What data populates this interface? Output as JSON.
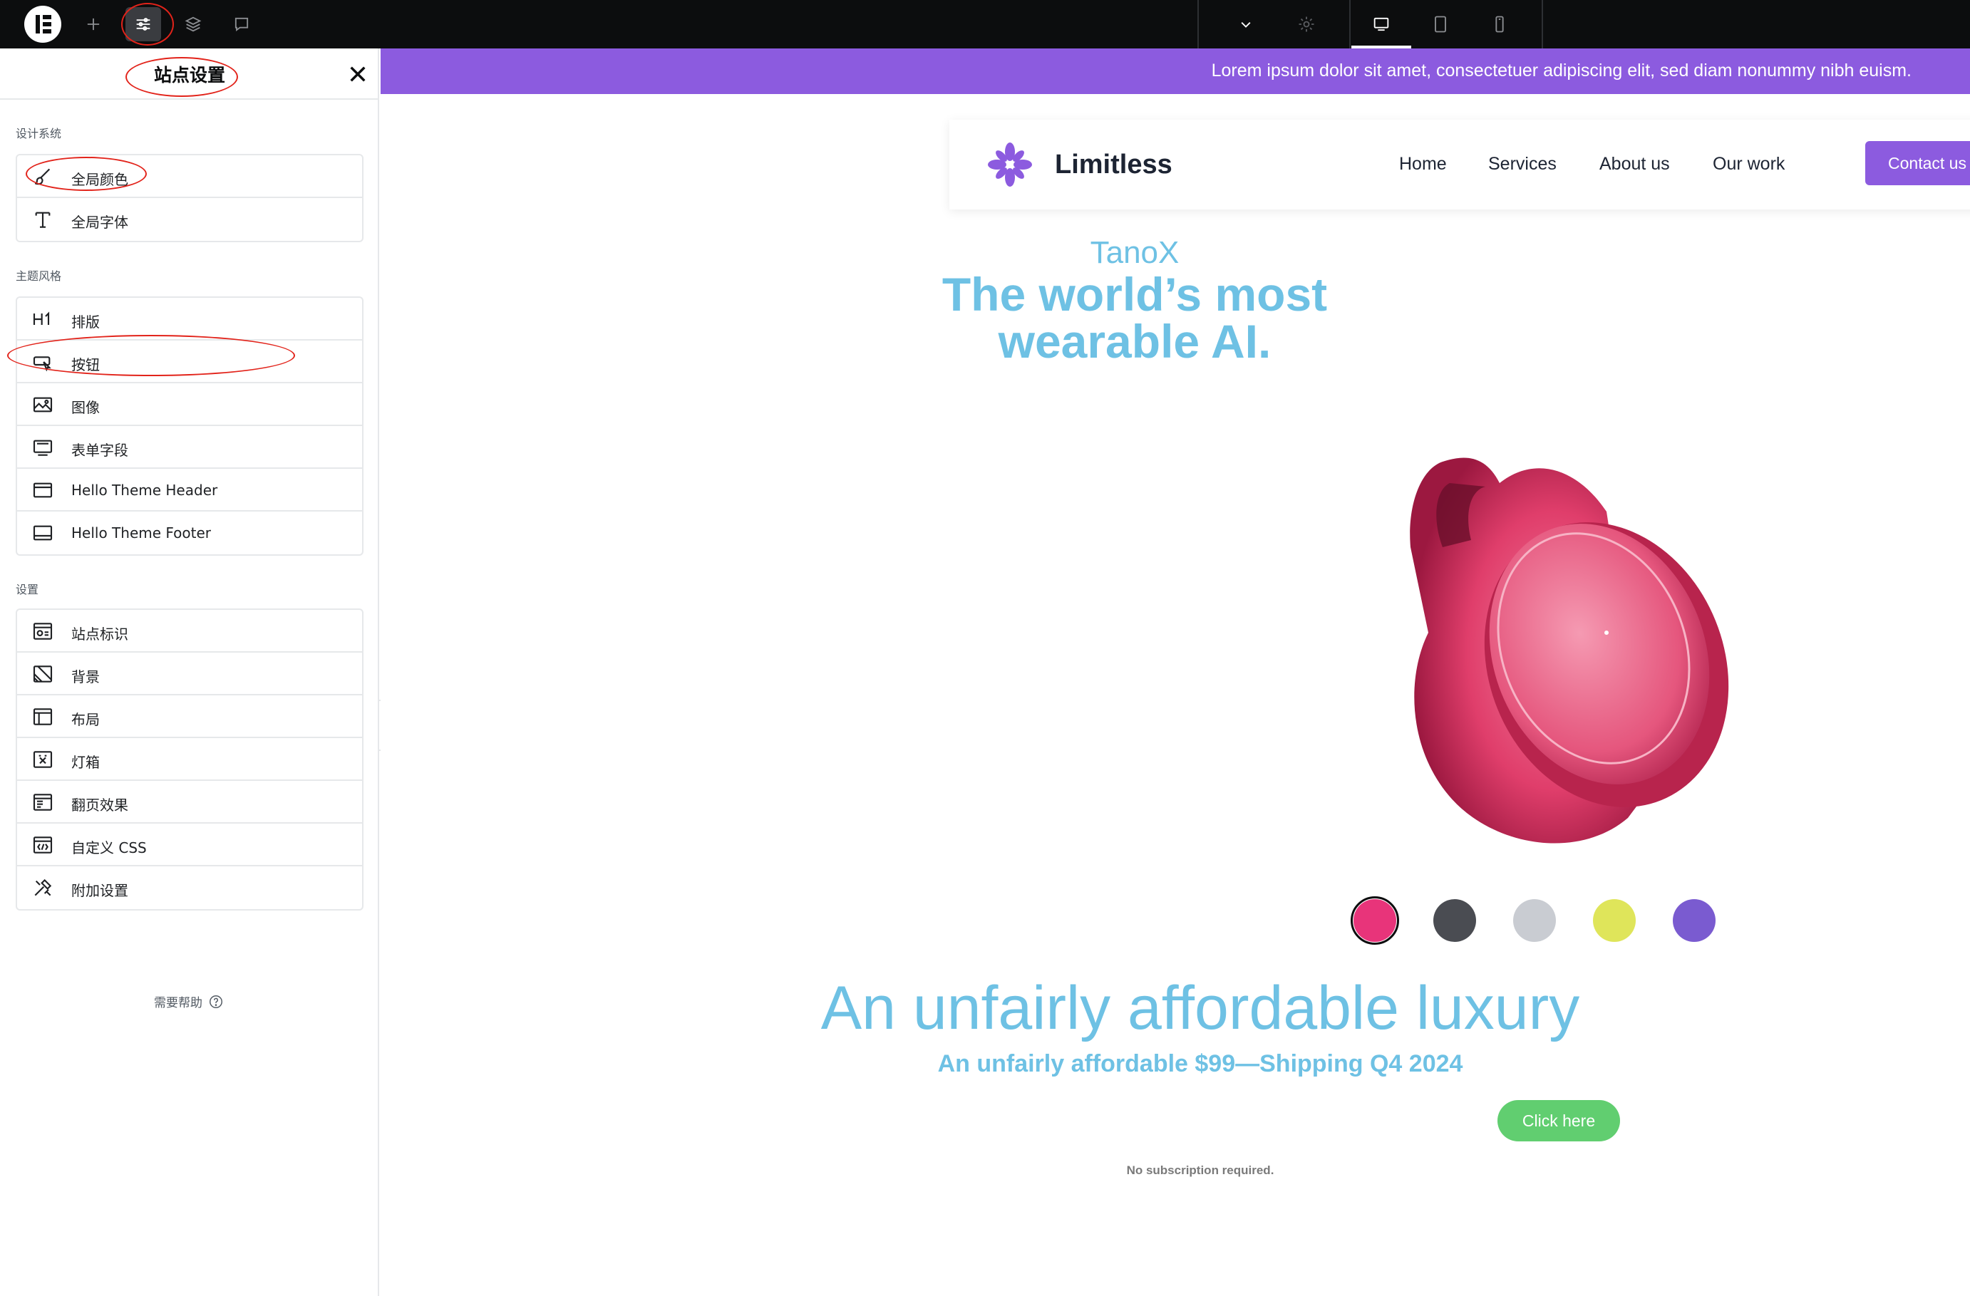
{
  "toolbar": {
    "icons": [
      "elementor-logo-icon",
      "add-element-icon",
      "site-settings-icon",
      "structure-icon",
      "notes-icon",
      "chevron-down-icon",
      "gear-icon",
      "desktop-icon",
      "tablet-icon",
      "mobile-icon"
    ],
    "active_tool": "site-settings-icon",
    "active_device": "desktop-icon"
  },
  "panel": {
    "title": "站点设置",
    "sections": [
      {
        "label": "设计系统",
        "items": [
          {
            "label": "全局颜色",
            "icon": "brush-icon"
          },
          {
            "label": "全局字体",
            "icon": "typography-icon"
          }
        ]
      },
      {
        "label": "主题风格",
        "items": [
          {
            "label": "排版",
            "icon": "heading-icon"
          },
          {
            "label": "按钮",
            "icon": "button-icon"
          },
          {
            "label": "图像",
            "icon": "image-icon"
          },
          {
            "label": "表单字段",
            "icon": "form-field-icon"
          },
          {
            "label": "Hello Theme Header",
            "icon": "header-icon"
          },
          {
            "label": "Hello Theme Footer",
            "icon": "footer-icon"
          }
        ]
      },
      {
        "label": "设置",
        "items": [
          {
            "label": "站点标识",
            "icon": "site-identity-icon"
          },
          {
            "label": "背景",
            "icon": "background-icon"
          },
          {
            "label": "布局",
            "icon": "layout-icon"
          },
          {
            "label": "灯箱",
            "icon": "lightbox-icon"
          },
          {
            "label": "翻页效果",
            "icon": "page-transitions-icon"
          },
          {
            "label": "自定义 CSS",
            "icon": "custom-css-icon"
          },
          {
            "label": "附加设置",
            "icon": "additional-settings-icon"
          }
        ]
      }
    ],
    "help_label": "需要帮助"
  },
  "preview": {
    "announcement": "Lorem ipsum dolor sit amet, consectetuer adipiscing elit, sed diam nonummy nibh euism.",
    "brand": "Limitless",
    "nav": [
      "Home",
      "Services",
      "About us",
      "Our work"
    ],
    "contact_label": "Contact us",
    "hero_kicker": "TanoX",
    "hero_title_line1": "The world’s most",
    "hero_title_line2": "wearable AI.",
    "swatch_colors": [
      "#e8347a",
      "#4a4c52",
      "#c9ccd2",
      "#dfe55a",
      "#7a5bd0"
    ],
    "selected_swatch": 0,
    "headline": "An unfairly affordable luxury",
    "subheadline": "An unfairly affordable $99—Shipping Q4 2024",
    "cta_label": "Click here",
    "note": "No subscription required."
  },
  "colors": {
    "toolbar_bg": "#0c0d0e",
    "announcement_bg": "#8c5bdf",
    "accent": "#6ec1e4",
    "cta": "#61ce70",
    "annotation_red": "#e2231a"
  }
}
